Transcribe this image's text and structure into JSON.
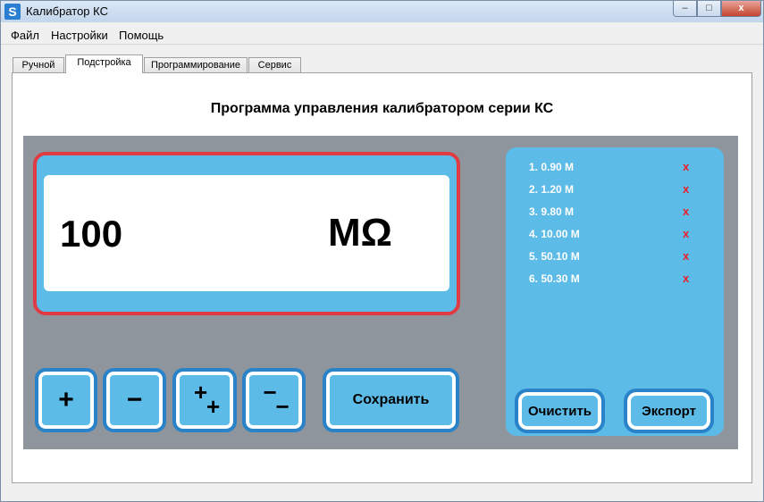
{
  "window": {
    "title": "Калибратор КС",
    "app_icon_letter": "S",
    "controls": {
      "minimize": "–",
      "maximize": "□",
      "close": "x"
    }
  },
  "menu": [
    "Файл",
    "Настройки",
    "Помощь"
  ],
  "tabs": [
    {
      "label": "Ручной",
      "active": false
    },
    {
      "label": "Подстройка",
      "active": true
    },
    {
      "label": "Программирование",
      "active": false
    },
    {
      "label": "Сервис",
      "active": false
    }
  ],
  "heading": "Программа управления калибратором серии КС",
  "display": {
    "value": "100",
    "unit": "MΩ"
  },
  "controls": {
    "plus": "+",
    "minus": "−",
    "plus_plus": [
      "+",
      "+"
    ],
    "minus_minus": [
      "−",
      "−"
    ],
    "save": "Сохранить"
  },
  "saved_list": {
    "items": [
      {
        "label": "1.  0.90 M",
        "delete": "x"
      },
      {
        "label": "2.  1.20 M",
        "delete": "x"
      },
      {
        "label": "3.  9.80 M",
        "delete": "x"
      },
      {
        "label": "4.  10.00 M",
        "delete": "x"
      },
      {
        "label": "5.  50.10 M",
        "delete": "x"
      },
      {
        "label": "6.  50.30 M",
        "delete": "x"
      }
    ],
    "clear_label": "Очистить",
    "export_label": "Экспорт"
  },
  "colors": {
    "panel_blue": "#5dbbe8",
    "border_blue": "#2a82c9",
    "display_border_red": "#e03b42",
    "delete_red": "#e8202a",
    "gray_area": "#8f959c"
  }
}
